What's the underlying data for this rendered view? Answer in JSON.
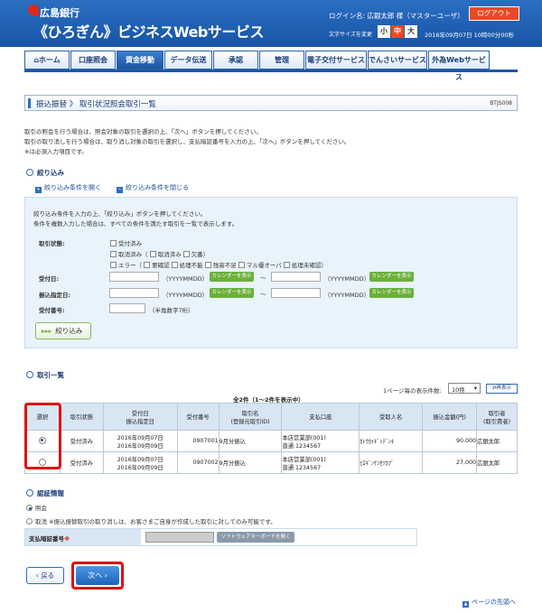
{
  "header": {
    "bank_name": "広島銀行",
    "service_title": "《ひろぎん》ビジネスWebサービス",
    "login_info": "ログイン名: 広銀太郎 様（マスターユーザ）",
    "logout_label": "ログアウト",
    "font_size_label": "文字サイズを変更",
    "font_small": "小",
    "font_medium": "中",
    "font_large": "大",
    "datetime": "2016年09月07日 10時00分00秒"
  },
  "nav": {
    "tabs": [
      "ホーム",
      "口座照会",
      "資金移動",
      "データ伝送",
      "承認",
      "管理",
      "電子交付サービス",
      "でんさいサービス",
      "外為Webサービス"
    ],
    "active": "資金移動"
  },
  "page": {
    "title": "振込振替 》 取引状況照会取引一覧",
    "screen_id": "BTJS008"
  },
  "intro": [
    "取引の照会を行う場合は、照会対象の取引を選択の上、「次へ」ボタンを押してください。",
    "取引の取り消しを行う場合は、取り消し対象の取引を選択し、支払暗証番号を入力の上、「次へ」ボタンを押してください。",
    "※は必須入力項目です。"
  ],
  "filter": {
    "heading": "絞り込み",
    "open_link": "絞り込み条件を開く",
    "close_link": "絞り込み条件を閉じる",
    "desc1": "絞り込み条件を入力の上、「絞り込み」ボタンを押してください。",
    "desc2": "条件を複数入力した場合は、すべての条件を満たす取引を一覧で表示します。",
    "status_label": "取引状態:",
    "statuses": [
      "受付済み",
      "取消済み（",
      "取消済み",
      "欠番",
      "）",
      "エラー（",
      "要確認",
      "処理不能",
      "残高不足",
      "マル優オーバ",
      "処理未確認",
      "）"
    ],
    "received_date_label": "受付日:",
    "transfer_date_label": "振込指定日:",
    "receipt_no_label": "受付番号:",
    "date_format": "（YYYYMMDD）",
    "calendar_btn": "カレンダーを表示",
    "tilde": "〜",
    "receipt_hint": "（半角数字7桁）",
    "button": "絞り込み"
  },
  "list": {
    "heading": "取引一覧",
    "per_page_label": "1ページ毎の表示件数:",
    "per_page_value": "10件",
    "redisplay": "再表示",
    "count_text": "全2件（1〜2件を表示中）",
    "headers": [
      "選択",
      "取引状態",
      "受付日\n振込指定日",
      "受付番号",
      "取引名\n(登録元取引ID)",
      "支払口座",
      "受取人名",
      "振込金額(円)",
      "取引者\n(取引責者)"
    ],
    "rows": [
      {
        "status": "受付済み",
        "date1": "2016年09月07日",
        "date2": "2016年09月09日",
        "no": "0907001",
        "name": "9月分振込",
        "acct1": "本店営業部(001)",
        "acct2": "普通 1234567",
        "payee": "ｶﾄｳｶｲｷﾞﾝﾃﾞﾝｷ",
        "amount": "90,000",
        "user": "広銀太郎",
        "selected": true
      },
      {
        "status": "受付済み",
        "date1": "2016年09月07日",
        "date2": "2016年09月09日",
        "no": "0907002",
        "name": "9月分振込",
        "acct1": "本店営業部(001)",
        "acct2": "普通 1234567",
        "payee": "ﾋﾛｷﾞﾝｹﾝｾﾂｶﾌﾞ",
        "amount": "27,000",
        "user": "広銀太郎",
        "selected": false
      }
    ]
  },
  "auth": {
    "heading": "認証情報",
    "opt1": "照会",
    "opt2": "取消",
    "opt2_note": "※振込振替取引の取り消しは、お客さまご自身が作成した取引に対してのみ可能です。",
    "pin_label": "支払暗証番号",
    "required": "※",
    "swkb": "ソフトウェアキーボードを開く"
  },
  "buttons": {
    "back": "戻る",
    "next": "次へ"
  },
  "footer": {
    "pagetop": "ページの先頭へ"
  }
}
